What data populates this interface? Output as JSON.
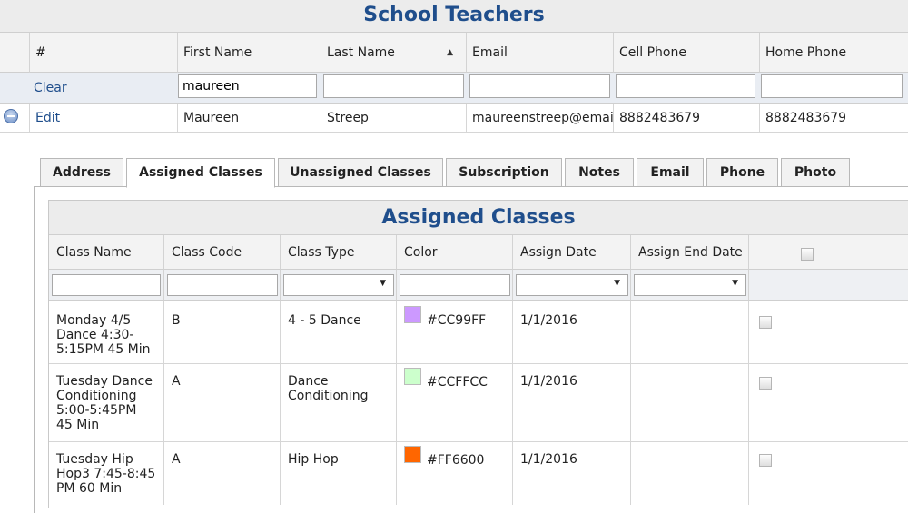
{
  "page_title": "School Teachers",
  "columns": [
    "#",
    "First Name",
    "Last Name",
    "Email",
    "Cell Phone",
    "Home Phone"
  ],
  "filters": {
    "clear_label": "Clear",
    "first_name_value": "maureen",
    "last_name_value": "",
    "email_value": "",
    "cell_value": "",
    "home_value": ""
  },
  "teacher": {
    "edit_label": "Edit",
    "first_name": "Maureen",
    "last_name": "Streep",
    "email": "maureenstreep@emai",
    "cell_phone": "8882483679",
    "home_phone": "8882483679"
  },
  "tabs": [
    "Address",
    "Assigned Classes",
    "Unassigned Classes",
    "Subscription",
    "Notes",
    "Email",
    "Phone",
    "Photo"
  ],
  "active_tab": "Assigned Classes",
  "assigned": {
    "title": "Assigned Classes",
    "columns": [
      "Class Name",
      "Class Code",
      "Class Type",
      "Color",
      "Assign Date",
      "Assign End Date"
    ],
    "rows": [
      {
        "class_name": "Monday 4/5 Dance 4:30-5:15PM 45 Min",
        "class_code": "B",
        "class_type": "4 - 5 Dance",
        "color": "#CC99FF",
        "assign_date": "1/1/2016",
        "assign_end_date": ""
      },
      {
        "class_name": "Tuesday Dance Conditioning 5:00-5:45PM 45 Min",
        "class_code": "A",
        "class_type": "Dance Conditioning",
        "color": "#CCFFCC",
        "assign_date": "1/1/2016",
        "assign_end_date": ""
      },
      {
        "class_name": "Tuesday Hip Hop3 7:45-8:45 PM 60 Min",
        "class_code": "A",
        "class_type": "Hip Hop",
        "color": "#FF6600",
        "assign_date": "1/1/2016",
        "assign_end_date": ""
      }
    ]
  }
}
